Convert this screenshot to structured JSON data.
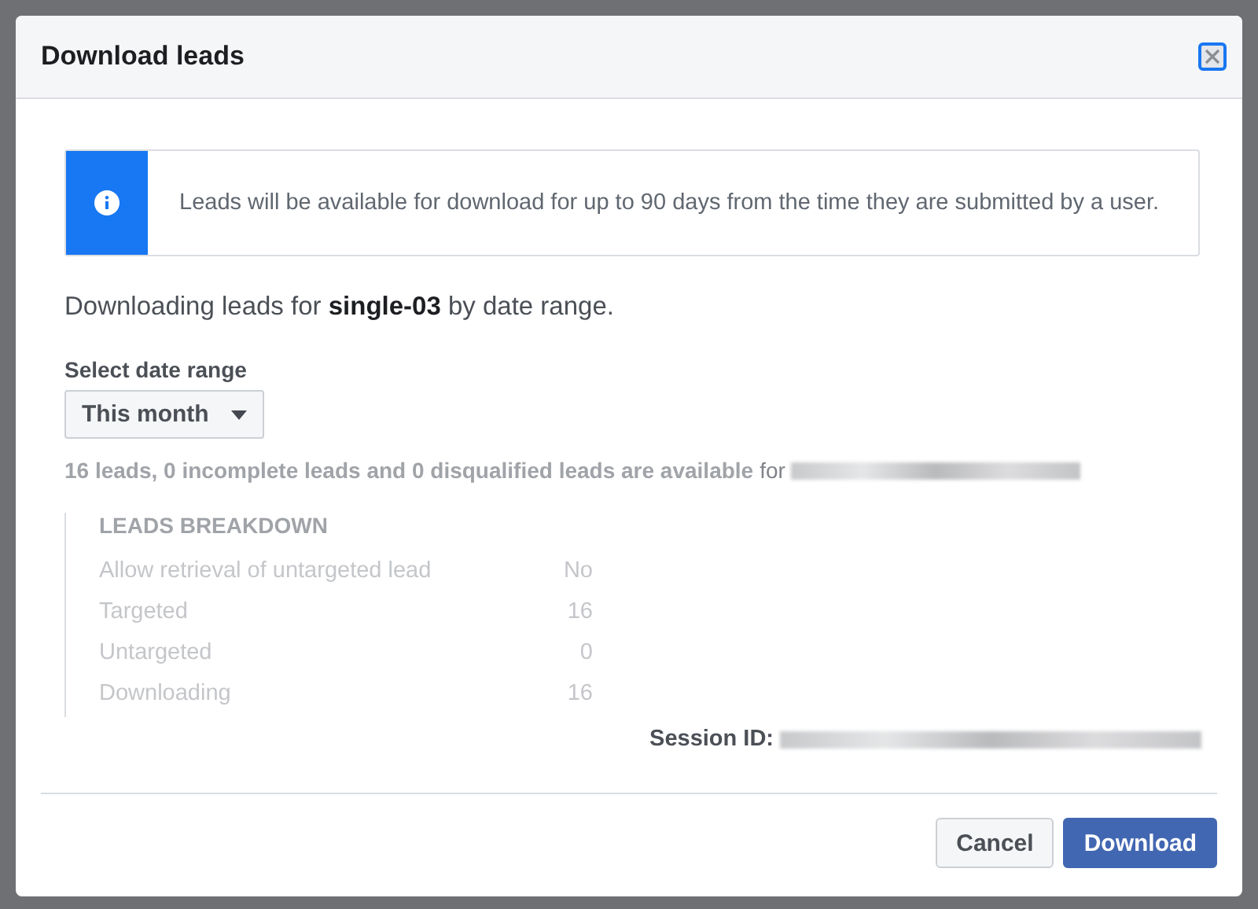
{
  "dialog": {
    "title": "Download leads"
  },
  "notice": {
    "text": "Leads will be available for download for up to 90 days from the time they are submitted by a user."
  },
  "intro": "Downloading leads for **single-03** by date range.",
  "date_range": {
    "label": "Select date range",
    "value": "This month"
  },
  "availability": {
    "text": "16 leads, 0 incomplete leads and 0 disqualified leads are available",
    "suffix": "for"
  },
  "breakdown": {
    "title": "LEADS BREAKDOWN",
    "rows": [
      {
        "label": "Allow retrieval of untargeted lead",
        "value": "No"
      },
      {
        "label": "Targeted",
        "value": "16"
      },
      {
        "label": "Untargeted",
        "value": "0"
      },
      {
        "label": "Downloading",
        "value": "16"
      }
    ]
  },
  "session": {
    "label": "Session ID:"
  },
  "buttons": [
    {
      "label": "Cancel",
      "kind": "secondary"
    },
    {
      "label": "Download",
      "kind": "primary"
    }
  ]
}
